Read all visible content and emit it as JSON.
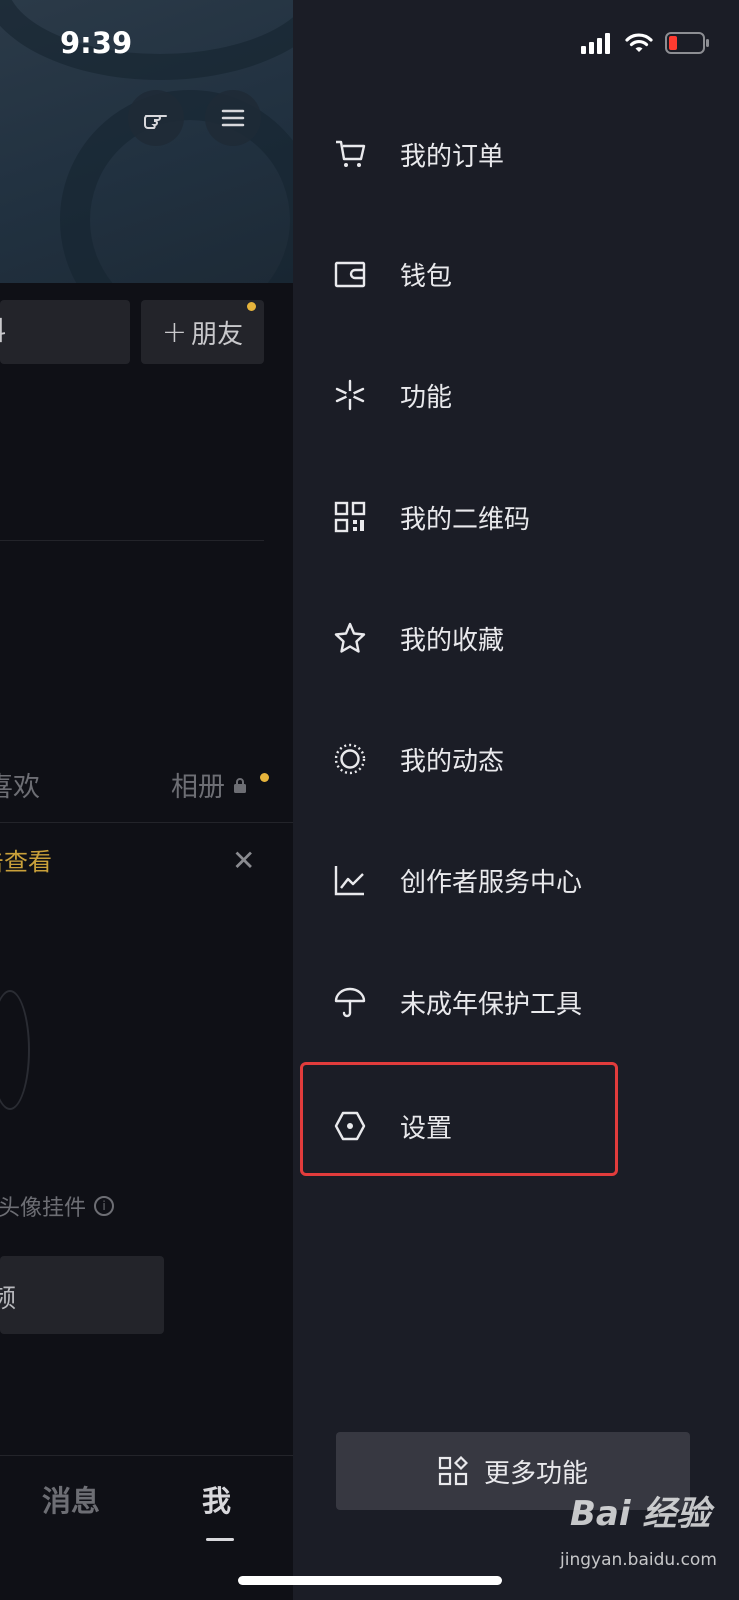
{
  "status_bar": {
    "time": "9:39"
  },
  "profile": {
    "edit_button_fragment": "料",
    "add_friend_label": "朋友",
    "tab_like_fragment": "喜欢",
    "tab_album": "相册",
    "notice_fragment": "击查看",
    "pendant_fragment": "属头像挂件",
    "video_button_fragment": "频"
  },
  "bottom_nav": {
    "messages": "消息",
    "me": "我"
  },
  "drawer": {
    "items": [
      {
        "label": "我的订单",
        "icon": "cart-icon"
      },
      {
        "label": "钱包",
        "icon": "wallet-icon"
      },
      {
        "label": "功能",
        "icon": "sparkle-icon"
      },
      {
        "label": "我的二维码",
        "icon": "qr-code-icon"
      },
      {
        "label": "我的收藏",
        "icon": "star-icon"
      },
      {
        "label": "我的动态",
        "icon": "moments-circle-icon"
      },
      {
        "label": "创作者服务中心",
        "icon": "line-chart-icon"
      },
      {
        "label": "未成年保护工具",
        "icon": "umbrella-icon"
      },
      {
        "label": "设置",
        "icon": "hexagon-settings-icon"
      }
    ],
    "more_label": "更多功能"
  },
  "watermark": {
    "brand": "Bai 经验",
    "site": "jingyan.baidu.com"
  },
  "colors": {
    "drawer_bg": "#1b1d26",
    "highlight": "#e23c3c",
    "notice": "#c9a03a"
  }
}
